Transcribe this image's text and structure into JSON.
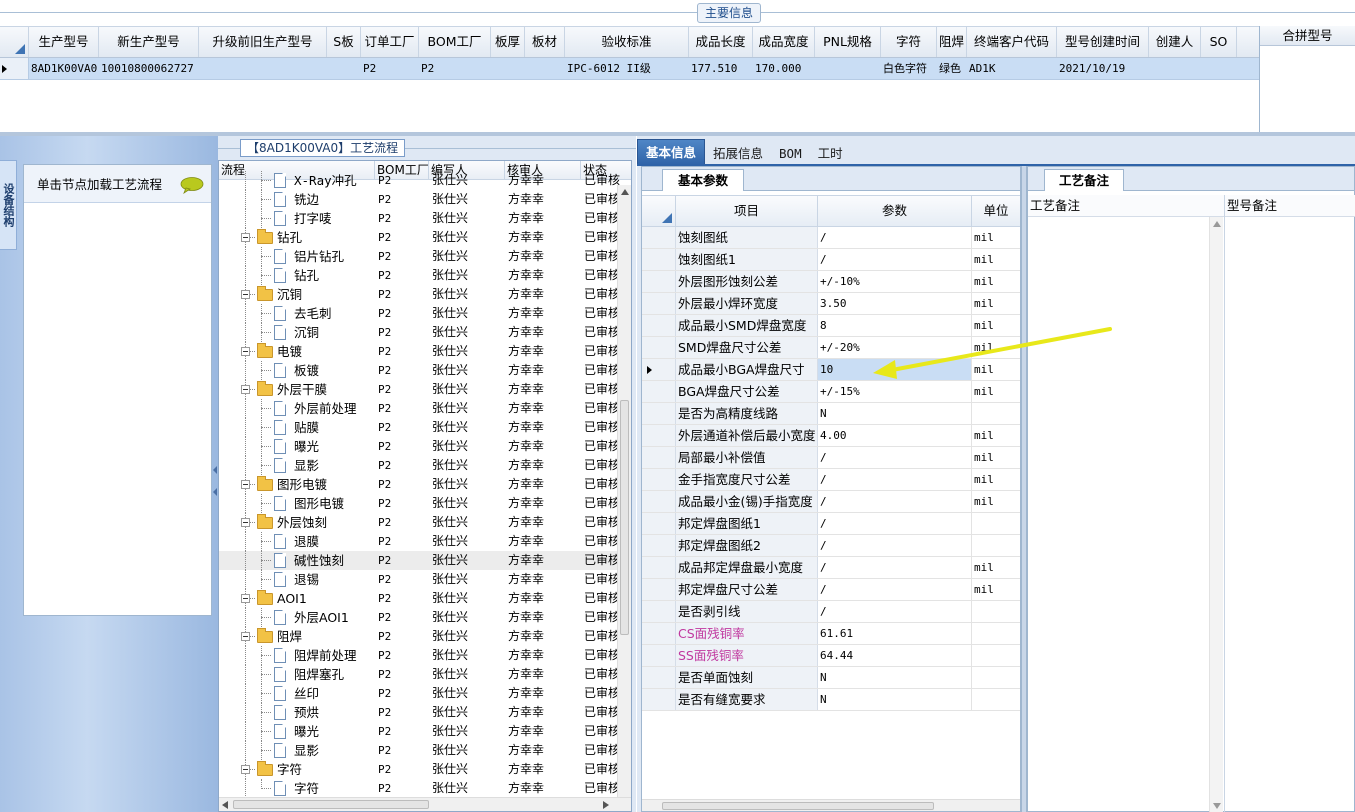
{
  "top": {
    "title": "主要信息",
    "columns": [
      "生产型号",
      "新生产型号",
      "升级前旧生产型号",
      "S板",
      "订单工厂",
      "BOM工厂",
      "板厚",
      "板材",
      "验收标准",
      "成品长度",
      "成品宽度",
      "PNL规格",
      "字符",
      "阻焊",
      "终端客户代码",
      "型号创建时间",
      "创建人",
      "SO"
    ],
    "row": [
      "8AD1K00VA0",
      "10010800062727",
      "",
      "",
      "P2",
      "P2",
      "",
      "",
      "IPC-6012 II级",
      "177.510",
      "170.000",
      "",
      "白色字符",
      "绿色",
      "AD1K",
      "2021/10/19",
      "",
      ""
    ],
    "merge_header": "合拼型号"
  },
  "left": {
    "vtab": "设备结构",
    "card_title": "单击节点加载工艺流程"
  },
  "tree": {
    "title": "【8AD1K00VA0】工艺流程",
    "headers": [
      "流程",
      "BOM工厂",
      "编写人",
      "核审人",
      "状态"
    ],
    "rows": [
      {
        "label": "X-Ray冲孔",
        "bom": "P2",
        "writer": "张仕兴",
        "reviewer": "方幸幸",
        "status": "已审核",
        "type": "leaf",
        "level": 1
      },
      {
        "label": "铣边",
        "bom": "P2",
        "writer": "张仕兴",
        "reviewer": "方幸幸",
        "status": "已审核",
        "type": "leaf",
        "level": 1
      },
      {
        "label": "打字唛",
        "bom": "P2",
        "writer": "张仕兴",
        "reviewer": "方幸幸",
        "status": "已审核",
        "type": "leaf",
        "level": 1
      },
      {
        "label": "钻孔",
        "bom": "P2",
        "writer": "张仕兴",
        "reviewer": "方幸幸",
        "status": "已审核",
        "type": "folder",
        "level": 0
      },
      {
        "label": "铝片钻孔",
        "bom": "P2",
        "writer": "张仕兴",
        "reviewer": "方幸幸",
        "status": "已审核",
        "type": "leaf",
        "level": 1
      },
      {
        "label": "钻孔",
        "bom": "P2",
        "writer": "张仕兴",
        "reviewer": "方幸幸",
        "status": "已审核",
        "type": "leaf",
        "level": 1
      },
      {
        "label": "沉铜",
        "bom": "P2",
        "writer": "张仕兴",
        "reviewer": "方幸幸",
        "status": "已审核",
        "type": "folder",
        "level": 0
      },
      {
        "label": "去毛刺",
        "bom": "P2",
        "writer": "张仕兴",
        "reviewer": "方幸幸",
        "status": "已审核",
        "type": "leaf",
        "level": 1
      },
      {
        "label": "沉铜",
        "bom": "P2",
        "writer": "张仕兴",
        "reviewer": "方幸幸",
        "status": "已审核",
        "type": "leaf",
        "level": 1
      },
      {
        "label": "电镀",
        "bom": "P2",
        "writer": "张仕兴",
        "reviewer": "方幸幸",
        "status": "已审核",
        "type": "folder",
        "level": 0
      },
      {
        "label": "板镀",
        "bom": "P2",
        "writer": "张仕兴",
        "reviewer": "方幸幸",
        "status": "已审核",
        "type": "leaf",
        "level": 1
      },
      {
        "label": "外层干膜",
        "bom": "P2",
        "writer": "张仕兴",
        "reviewer": "方幸幸",
        "status": "已审核",
        "type": "folder",
        "level": 0
      },
      {
        "label": "外层前处理",
        "bom": "P2",
        "writer": "张仕兴",
        "reviewer": "方幸幸",
        "status": "已审核",
        "type": "leaf",
        "level": 1
      },
      {
        "label": "贴膜",
        "bom": "P2",
        "writer": "张仕兴",
        "reviewer": "方幸幸",
        "status": "已审核",
        "type": "leaf",
        "level": 1
      },
      {
        "label": "曝光",
        "bom": "P2",
        "writer": "张仕兴",
        "reviewer": "方幸幸",
        "status": "已审核",
        "type": "leaf",
        "level": 1
      },
      {
        "label": "显影",
        "bom": "P2",
        "writer": "张仕兴",
        "reviewer": "方幸幸",
        "status": "已审核",
        "type": "leaf",
        "level": 1
      },
      {
        "label": "图形电镀",
        "bom": "P2",
        "writer": "张仕兴",
        "reviewer": "方幸幸",
        "status": "已审核",
        "type": "folder",
        "level": 0
      },
      {
        "label": "图形电镀",
        "bom": "P2",
        "writer": "张仕兴",
        "reviewer": "方幸幸",
        "status": "已审核",
        "type": "leaf",
        "level": 1
      },
      {
        "label": "外层蚀刻",
        "bom": "P2",
        "writer": "张仕兴",
        "reviewer": "方幸幸",
        "status": "已审核",
        "type": "folder",
        "level": 0
      },
      {
        "label": "退膜",
        "bom": "P2",
        "writer": "张仕兴",
        "reviewer": "方幸幸",
        "status": "已审核",
        "type": "leaf",
        "level": 1
      },
      {
        "label": "碱性蚀刻",
        "bom": "P2",
        "writer": "张仕兴",
        "reviewer": "方幸幸",
        "status": "已审核",
        "type": "leaf",
        "level": 1,
        "selected": true
      },
      {
        "label": "退锡",
        "bom": "P2",
        "writer": "张仕兴",
        "reviewer": "方幸幸",
        "status": "已审核",
        "type": "leaf",
        "level": 1
      },
      {
        "label": "AOI1",
        "bom": "P2",
        "writer": "张仕兴",
        "reviewer": "方幸幸",
        "status": "已审核",
        "type": "folder",
        "level": 0
      },
      {
        "label": "外层AOI1",
        "bom": "P2",
        "writer": "张仕兴",
        "reviewer": "方幸幸",
        "status": "已审核",
        "type": "leaf",
        "level": 1
      },
      {
        "label": "阻焊",
        "bom": "P2",
        "writer": "张仕兴",
        "reviewer": "方幸幸",
        "status": "已审核",
        "type": "folder",
        "level": 0
      },
      {
        "label": "阻焊前处理",
        "bom": "P2",
        "writer": "张仕兴",
        "reviewer": "方幸幸",
        "status": "已审核",
        "type": "leaf",
        "level": 1
      },
      {
        "label": "阻焊塞孔",
        "bom": "P2",
        "writer": "张仕兴",
        "reviewer": "方幸幸",
        "status": "已审核",
        "type": "leaf",
        "level": 1
      },
      {
        "label": "丝印",
        "bom": "P2",
        "writer": "张仕兴",
        "reviewer": "方幸幸",
        "status": "已审核",
        "type": "leaf",
        "level": 1
      },
      {
        "label": "预烘",
        "bom": "P2",
        "writer": "张仕兴",
        "reviewer": "方幸幸",
        "status": "已审核",
        "type": "leaf",
        "level": 1
      },
      {
        "label": "曝光",
        "bom": "P2",
        "writer": "张仕兴",
        "reviewer": "方幸幸",
        "status": "已审核",
        "type": "leaf",
        "level": 1
      },
      {
        "label": "显影",
        "bom": "P2",
        "writer": "张仕兴",
        "reviewer": "方幸幸",
        "status": "已审核",
        "type": "leaf",
        "level": 1
      },
      {
        "label": "字符",
        "bom": "P2",
        "writer": "张仕兴",
        "reviewer": "方幸幸",
        "status": "已审核",
        "type": "folder",
        "level": 0
      },
      {
        "label": "字符",
        "bom": "P2",
        "writer": "张仕兴",
        "reviewer": "方幸幸",
        "status": "已审核",
        "type": "leaf",
        "level": 1
      }
    ]
  },
  "tabs": [
    "基本信息",
    "拓展信息",
    "BOM",
    "工时"
  ],
  "basic": {
    "tab": "基本参数",
    "headers": [
      "项目",
      "参数",
      "单位"
    ],
    "rows": [
      {
        "item": "蚀刻图纸",
        "param": "/",
        "unit": "mil"
      },
      {
        "item": "蚀刻图纸1",
        "param": "/",
        "unit": "mil"
      },
      {
        "item": "外层图形蚀刻公差",
        "param": "+/-10%",
        "unit": "mil"
      },
      {
        "item": "外层最小焊环宽度",
        "param": "3.50",
        "unit": "mil"
      },
      {
        "item": "成品最小SMD焊盘宽度",
        "param": "8",
        "unit": "mil"
      },
      {
        "item": "SMD焊盘尺寸公差",
        "param": "+/-20%",
        "unit": "mil"
      },
      {
        "item": "成品最小BGA焊盘尺寸",
        "param": "10",
        "unit": "mil",
        "current": true
      },
      {
        "item": "BGA焊盘尺寸公差",
        "param": "+/-15%",
        "unit": "mil"
      },
      {
        "item": "是否为高精度线路",
        "param": "N",
        "unit": ""
      },
      {
        "item": "外层通道补偿后最小宽度",
        "param": "4.00",
        "unit": "mil"
      },
      {
        "item": "局部最小补偿值",
        "param": "/",
        "unit": "mil"
      },
      {
        "item": "金手指宽度尺寸公差",
        "param": "/",
        "unit": "mil"
      },
      {
        "item": "成品最小金(锡)手指宽度",
        "param": "/",
        "unit": "mil"
      },
      {
        "item": "邦定焊盘图纸1",
        "param": "/",
        "unit": ""
      },
      {
        "item": "邦定焊盘图纸2",
        "param": "/",
        "unit": ""
      },
      {
        "item": "成品邦定焊盘最小宽度",
        "param": "/",
        "unit": "mil"
      },
      {
        "item": "邦定焊盘尺寸公差",
        "param": "/",
        "unit": "mil"
      },
      {
        "item": "是否剥引线",
        "param": "/",
        "unit": ""
      },
      {
        "item": "CS面残铜率",
        "param": "61.61",
        "unit": "",
        "pink": true
      },
      {
        "item": "SS面残铜率",
        "param": "64.44",
        "unit": "",
        "pink": true
      },
      {
        "item": "是否单面蚀刻",
        "param": "N",
        "unit": ""
      },
      {
        "item": "是否有缝宽要求",
        "param": "N",
        "unit": ""
      }
    ]
  },
  "notes": {
    "tab": "工艺备注",
    "col1": "工艺备注",
    "col2": "型号备注"
  },
  "colors": {
    "accent": "#2f63a8",
    "selection": "#c9ddf4",
    "arrow": "#f2f22e",
    "pink": "#c0389f"
  }
}
